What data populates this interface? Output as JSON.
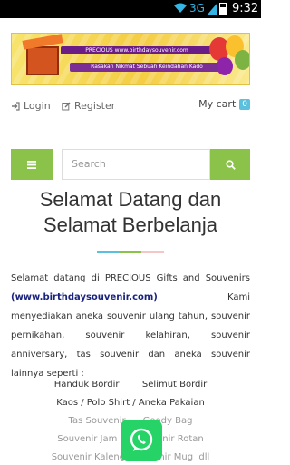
{
  "status": {
    "network": "3G",
    "time": "9:32"
  },
  "banner": {
    "url": "PRECIOUS www.birthdaysouvenir.com",
    "tagline": "Rasakan Nikmat Sebuah Keindahan Kado"
  },
  "nav": {
    "login": "Login",
    "register": "Register",
    "cart_label": "My cart",
    "cart_count": "0"
  },
  "search": {
    "placeholder": "Search"
  },
  "welcome": {
    "line1": "Selamat Datang dan",
    "line2": "Selamat Berbelanja"
  },
  "underline_colors": [
    "#5bc0de",
    "#8bc34a",
    "#f5c6c6"
  ],
  "intro": {
    "pre": "Selamat datang di PRECIOUS Gifts and Souvenirs",
    "link": "(www.birthdaysouvenir.com)",
    "post": ". Kami menyediakan aneka souvenir ulang tahun, souvenir pernikahan, souvenir kelahiran, souvenir anniversary, tas souvenir dan aneka souvenir lainnya seperti :"
  },
  "products": [
    "Handuk Bordir        Selimut Bordir",
    "Kaos / Polo Shirt / Aneka Pakaian",
    "Tas Souvenir      Goody Bag",
    "Souvenir Jam      Souvenir Rotan",
    "Souvenir Kaleng  Souvenir Mug  dll"
  ],
  "colors": {
    "accent": "#8bc34a",
    "cart_badge": "#5bc0de",
    "whatsapp": "#25d366"
  }
}
